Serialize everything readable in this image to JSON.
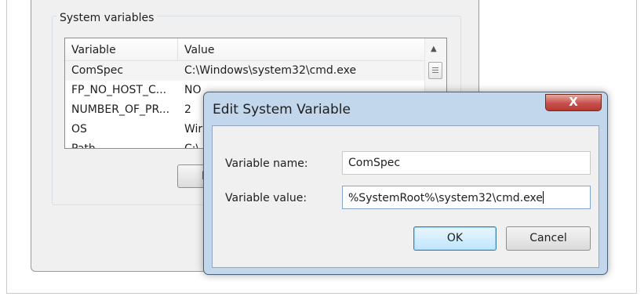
{
  "background_window": {
    "group_label": "System variables",
    "columns": [
      "Variable",
      "Value"
    ],
    "rows": [
      {
        "variable": "ComSpec",
        "value": "C:\\Windows\\system32\\cmd.exe"
      },
      {
        "variable": "FP_NO_HOST_C...",
        "value": "NO"
      },
      {
        "variable": "NUMBER_OF_PR...",
        "value": "2"
      },
      {
        "variable": "OS",
        "value": "Wir"
      },
      {
        "variable": "Path",
        "value": "C:\\"
      }
    ],
    "button_label": "N"
  },
  "dialog": {
    "title": "Edit System Variable",
    "close_label": "X",
    "name_label": "Variable name:",
    "name_value": "ComSpec",
    "value_label": "Variable value:",
    "value_value": "%SystemRoot%\\system32\\cmd.exe",
    "ok_label": "OK",
    "cancel_label": "Cancel"
  },
  "colors": {
    "dialog_frame": "#c2d6ec",
    "close_button": "#c75050",
    "ok_button": "#bee6fd"
  }
}
